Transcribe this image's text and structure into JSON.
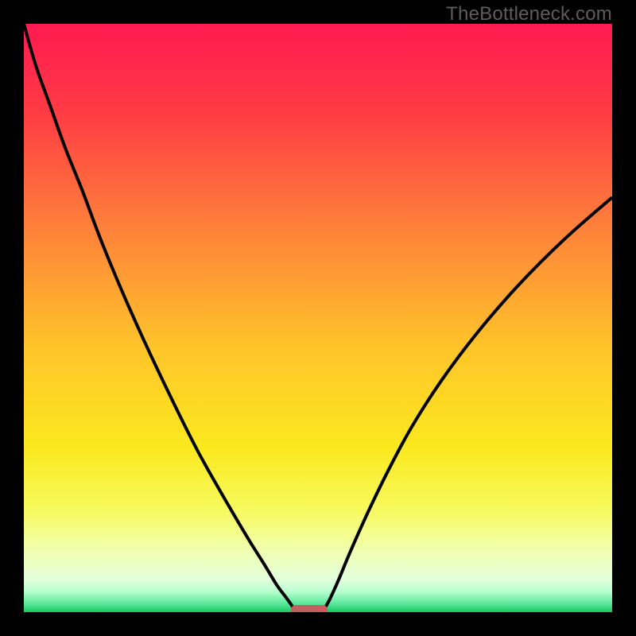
{
  "watermark": "TheBottleneck.com",
  "chart_data": {
    "type": "line",
    "title": "",
    "xlabel": "",
    "ylabel": "",
    "xlim": [
      0,
      100
    ],
    "ylim": [
      0,
      100
    ],
    "background_gradient_stops": [
      {
        "offset": 0.0,
        "color": "#ff1a50"
      },
      {
        "offset": 0.15,
        "color": "#ff3b45"
      },
      {
        "offset": 0.35,
        "color": "#ff823a"
      },
      {
        "offset": 0.55,
        "color": "#ffc42a"
      },
      {
        "offset": 0.72,
        "color": "#fbe91e"
      },
      {
        "offset": 0.83,
        "color": "#f7fb62"
      },
      {
        "offset": 0.9,
        "color": "#f0ffb5"
      },
      {
        "offset": 0.945,
        "color": "#e2ffdc"
      },
      {
        "offset": 0.965,
        "color": "#b8ffcf"
      },
      {
        "offset": 0.985,
        "color": "#5de89c"
      },
      {
        "offset": 1.0,
        "color": "#18c863"
      }
    ],
    "series": [
      {
        "name": "left-branch",
        "x": [
          0.0,
          2.0,
          4.5,
          7.0,
          10.0,
          13.0,
          16.5,
          20.5,
          25.0,
          29.5,
          34.0,
          38.0,
          41.0,
          43.0,
          44.5,
          45.5,
          46.0
        ],
        "values": [
          100.0,
          93.0,
          86.0,
          79.0,
          71.5,
          63.5,
          55.0,
          46.0,
          36.5,
          27.5,
          19.5,
          12.7,
          7.9,
          4.6,
          2.6,
          1.2,
          0.4
        ]
      },
      {
        "name": "right-branch",
        "x": [
          51.0,
          52.0,
          53.5,
          55.5,
          58.5,
          62.0,
          66.0,
          71.0,
          77.0,
          84.0,
          92.0,
          100.0
        ],
        "values": [
          0.4,
          2.2,
          5.5,
          10.3,
          17.0,
          24.2,
          31.6,
          39.4,
          47.4,
          55.5,
          63.5,
          70.5
        ]
      }
    ],
    "marker": {
      "name": "bottleneck-indicator",
      "x_start": 45.4,
      "x_end": 51.6,
      "y": 0.4,
      "height_pct": 1.6,
      "color": "#c65d60"
    }
  }
}
